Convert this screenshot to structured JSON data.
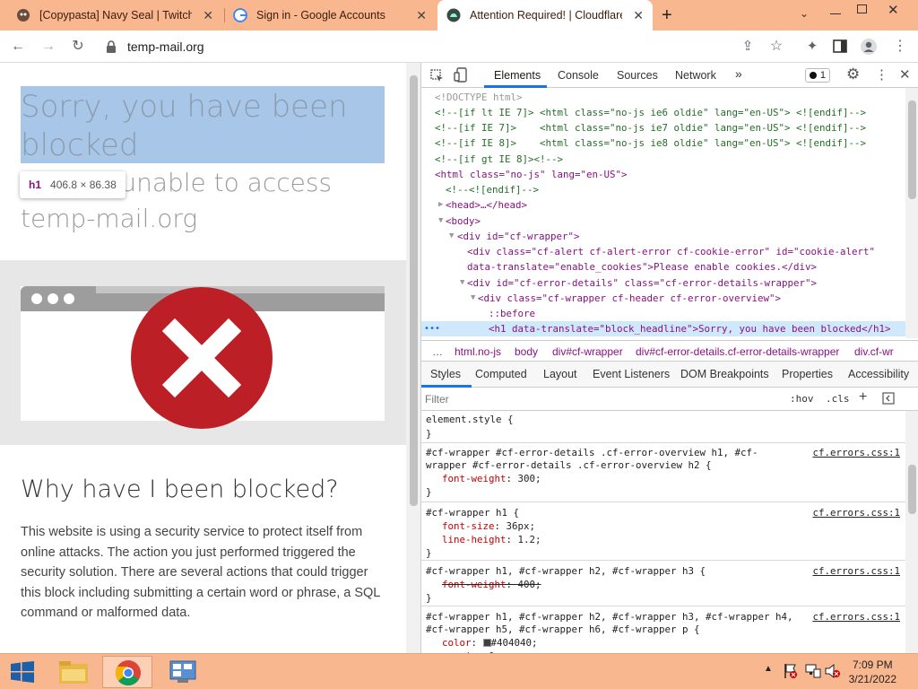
{
  "browser": {
    "tabs": [
      {
        "title": "[Copypasta] Navy Seal | TwitchQu",
        "favicon": "ghost-icon"
      },
      {
        "title": "Sign in - Google Accounts",
        "favicon": "google-icon"
      },
      {
        "title": "Attention Required! | Cloudflare",
        "favicon": "cloudflare-icon",
        "active": true
      }
    ],
    "new_tab": "+",
    "url": "temp-mail.org"
  },
  "page": {
    "headline": "Sorry, you have been blocked",
    "subheadline": "You are unable to access temp-mail.org",
    "tooltip": {
      "tag": "h1",
      "size": "406.8 × 86.38"
    },
    "why_title": "Why have I been blocked?",
    "why_text": "This website is using a security service to protect itself from online attacks. The action you just performed triggered the security solution. There are several actions that could trigger this block including submitting a certain word or phrase, a SQL command or malformed data."
  },
  "devtools": {
    "tabs": [
      "Elements",
      "Console",
      "Sources",
      "Network",
      "»"
    ],
    "issue_count": "1",
    "code_lines": [
      "<!DOCTYPE html>",
      "<!--[if lt IE 7]> <html class=\"no-js ie6 oldie\" lang=\"en-US\"> <![endif]-->",
      "<!--[if IE 7]>    <html class=\"no-js ie7 oldie\" lang=\"en-US\"> <![endif]-->",
      "<!--[if IE 8]>    <html class=\"no-js ie8 oldie\" lang=\"en-US\"> <![endif]-->",
      "<!--[if gt IE 8]><!-->",
      "<html class=\"no-js\" lang=\"en-US\">",
      "<!--<![endif]-->",
      "<head>…</head>",
      "<body>",
      "<div id=\"cf-wrapper\">",
      "<div class=\"cf-alert cf-alert-error cf-cookie-error\" id=\"cookie-alert\"",
      "data-translate=\"enable_cookies\">Please enable cookies.</div>",
      "<div id=\"cf-error-details\" class=\"cf-error-details-wrapper\">",
      "<div class=\"cf-wrapper cf-header cf-error-overview\">",
      "::before",
      "<h1 data-translate=\"block_headline\">Sorry, you have been blocked</h1>"
    ],
    "breadcrumbs": [
      "…",
      "html.no-js",
      "body",
      "div#cf-wrapper",
      "div#cf-error-details.cf-error-details-wrapper",
      "div.cf-wr"
    ],
    "style_tabs": [
      "Styles",
      "Computed",
      "Layout",
      "Event Listeners",
      "DOM Breakpoints",
      "Properties",
      "Accessibility"
    ],
    "filter_placeholder": "Filter",
    "hov": ":hov",
    "cls": ".cls",
    "rules": [
      {
        "selector": [
          "element.style {"
        ],
        "props": [],
        "source": ""
      },
      {
        "selector": [
          "#cf-wrapper #cf-error-details .cf-error-overview h1, #cf-",
          "wrapper #cf-error-details .cf-error-overview h2 {"
        ],
        "props": [
          {
            "name": "font-weight",
            "value": "300;"
          }
        ],
        "source": "cf.errors.css:1"
      },
      {
        "selector": [
          "#cf-wrapper h1 {"
        ],
        "props": [
          {
            "name": "font-size",
            "value": "36px;"
          },
          {
            "name": "line-height",
            "value": "1.2;"
          }
        ],
        "source": "cf.errors.css:1"
      },
      {
        "selector": [
          "#cf-wrapper h1, #cf-wrapper h2, #cf-wrapper h3 {"
        ],
        "props": [
          {
            "name": "font-weight",
            "value": "400;",
            "struck": true
          }
        ],
        "source": "cf.errors.css:1"
      },
      {
        "selector": [
          "#cf-wrapper h1, #cf-wrapper h2, #cf-wrapper h3, #cf-wrapper h4,",
          "#cf-wrapper h5, #cf-wrapper h6, #cf-wrapper p {"
        ],
        "props": [
          {
            "name": "color",
            "value": "#404040;"
          },
          {
            "name": "margin",
            "value": "0;"
          }
        ],
        "source": "cf.errors.css:1"
      }
    ]
  },
  "taskbar": {
    "time": "7:09 PM",
    "date": "3/21/2022"
  },
  "colors": {
    "accent": "#f8b78e",
    "error_red": "#bc1f26",
    "selection": "#a8c7e8"
  }
}
